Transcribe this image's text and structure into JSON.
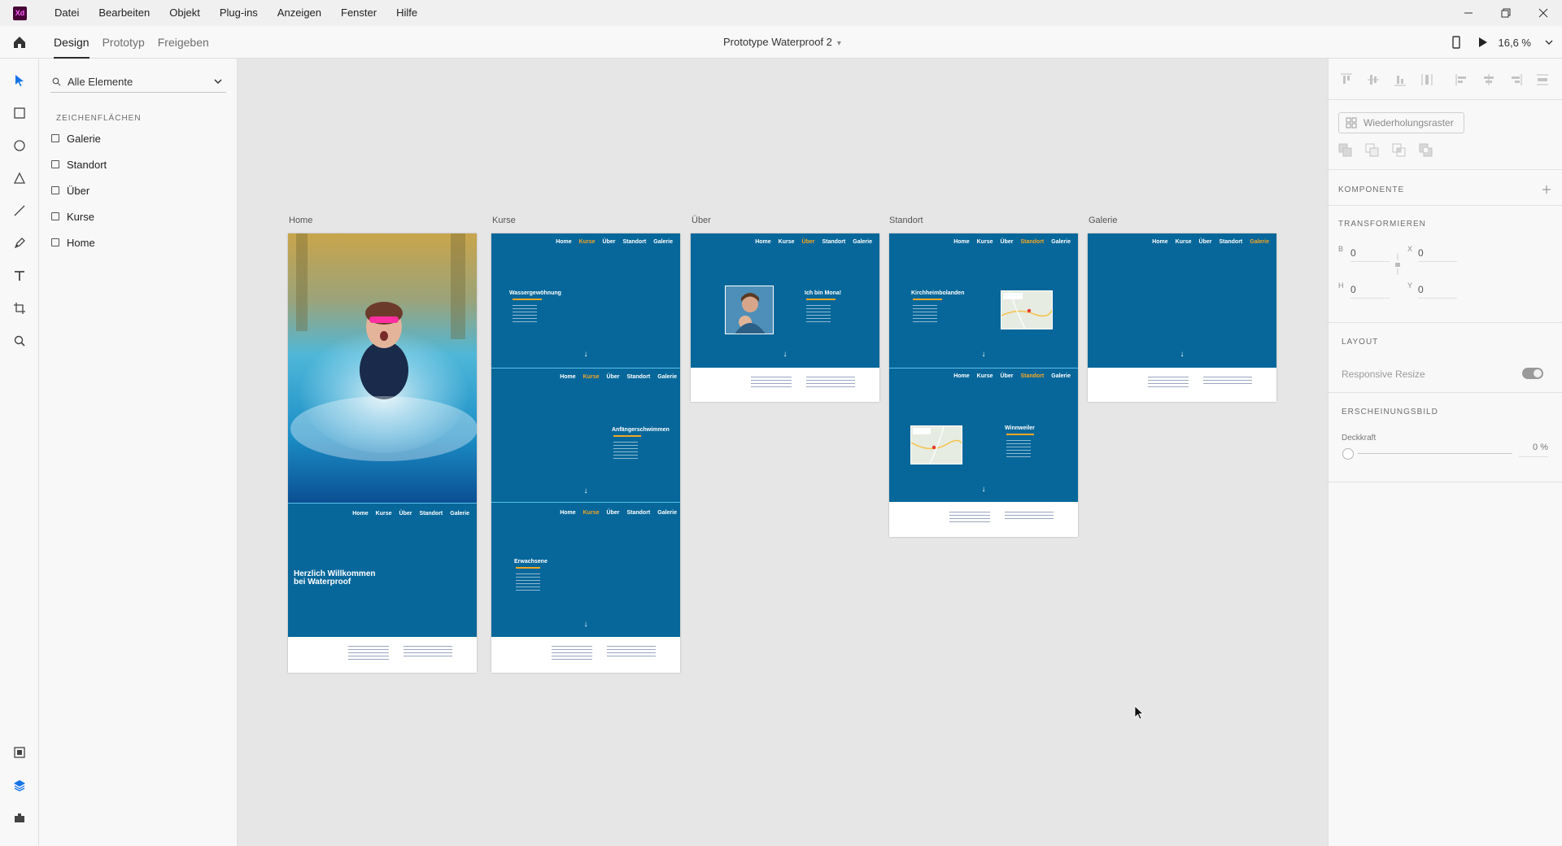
{
  "app": {
    "logo_text": "Xd",
    "menu": [
      "Datei",
      "Bearbeiten",
      "Objekt",
      "Plug-ins",
      "Anzeigen",
      "Fenster",
      "Hilfe"
    ]
  },
  "toolbar": {
    "tabs": [
      "Design",
      "Prototyp",
      "Freigeben"
    ],
    "active_tab": "Design",
    "document_title": "Prototype Waterproof 2",
    "zoom": "16,6 %"
  },
  "tools": [
    "select-tool",
    "rectangle-tool",
    "ellipse-tool",
    "polygon-tool",
    "line-tool",
    "pen-tool",
    "text-tool",
    "artboard-tool",
    "zoom-tool"
  ],
  "layers_panel": {
    "filter_label": "Alle Elemente",
    "section_title": "ZEICHENFLÄCHEN",
    "artboards": [
      "Galerie",
      "Standort",
      "Über",
      "Kurse",
      "Home"
    ]
  },
  "canvas": {
    "artboard_labels": [
      "Home",
      "Kurse",
      "Über",
      "Standort",
      "Galerie"
    ],
    "nav": [
      "Home",
      "Kurse",
      "Über",
      "Standort",
      "Galerie"
    ],
    "hero_title_line1": "Herzlich Willkommen",
    "hero_title_line2": "bei Waterproof",
    "kurse_sections": [
      "Wassergewöhnung",
      "Anfängerschwimmen",
      "Erwachsene"
    ],
    "ueber_title": "Ich bin Mona!",
    "standort_sections": [
      "Kirchheimbolanden",
      "Winnweiler"
    ],
    "arrow": "↓",
    "colors": {
      "brand_blue": "#07679a",
      "accent_orange": "#f5a623",
      "separator_cyan": "#58c2ea"
    }
  },
  "properties_panel": {
    "repeat_grid_label": "Wiederholungsraster",
    "component_label": "KOMPONENTE",
    "transform_label": "TRANSFORMIEREN",
    "fields": {
      "B": "0",
      "X": "0",
      "H": "0",
      "Y": "0"
    },
    "layout_label": "LAYOUT",
    "responsive_resize_label": "Responsive Resize",
    "appearance_label": "ERSCHEINUNGSBILD",
    "opacity_label": "Deckkraft",
    "opacity_value": "0 %"
  }
}
